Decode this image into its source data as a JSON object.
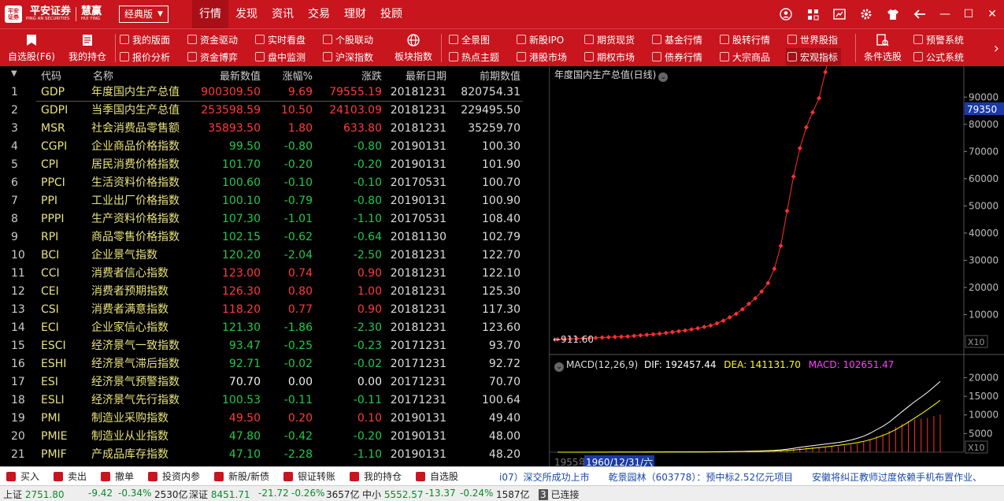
{
  "titlebar": {
    "logo_main": "平安证券",
    "logo_sub": "PING AN SECURITIES",
    "brand": "慧赢",
    "brand_sub": "HUI YING",
    "edition": "经典版",
    "tabs": [
      "行情",
      "发现",
      "资讯",
      "交易",
      "理财",
      "投顾"
    ],
    "active_tab": "行情"
  },
  "toolbar": {
    "big": [
      {
        "label": "自选股(F6)",
        "icon": "bookmark-icon"
      },
      {
        "label": "我的持仓",
        "icon": "document-icon"
      },
      {
        "label": "板块指数",
        "icon": "globe-icon"
      },
      {
        "label": "条件选股",
        "icon": "filter-doc-icon"
      }
    ],
    "small": [
      [
        "我的版面",
        "报价分析"
      ],
      [
        "资金驱动",
        "资金博弈"
      ],
      [
        "实时看盘",
        "盘中监测"
      ],
      [
        "个股联动",
        "沪深指数"
      ],
      [
        "全景图",
        "热点主题"
      ],
      [
        "新股IPO",
        "港股市场"
      ],
      [
        "期货现货",
        "期权市场"
      ],
      [
        "基金行情",
        "债券行情"
      ],
      [
        "股转行情",
        "大宗商品"
      ],
      [
        "世界股指",
        "宏观指标"
      ],
      [
        "预警系统",
        "公式系统"
      ]
    ],
    "selected": "宏观指标"
  },
  "table": {
    "headers": {
      "code": "代码",
      "name": "名称",
      "price": "最新数值",
      "pct": "涨幅%",
      "chg": "涨跌",
      "date": "最新日期",
      "prev": "前期数值"
    },
    "rows": [
      {
        "idx": "1",
        "code": "GDP",
        "name": "年度国内生产总值",
        "price": "900309.50",
        "pct": "9.69",
        "chg": "79555.19",
        "date": "20181231",
        "prev": "820754.31",
        "dir": "up"
      },
      {
        "idx": "2",
        "code": "GDPI",
        "name": "当季国内生产总值",
        "price": "253598.59",
        "pct": "10.50",
        "chg": "24103.09",
        "date": "20181231",
        "prev": "229495.50",
        "dir": "up"
      },
      {
        "idx": "3",
        "code": "MSR",
        "name": "社会消费品零售额",
        "price": "35893.50",
        "pct": "1.80",
        "chg": "633.80",
        "date": "20181231",
        "prev": "35259.70",
        "dir": "up"
      },
      {
        "idx": "4",
        "code": "CGPI",
        "name": "企业商品价格指数",
        "price": "99.50",
        "pct": "-0.80",
        "chg": "-0.80",
        "date": "20190131",
        "prev": "100.30",
        "dir": "down"
      },
      {
        "idx": "5",
        "code": "CPI",
        "name": "居民消费价格指数",
        "price": "101.70",
        "pct": "-0.20",
        "chg": "-0.20",
        "date": "20190131",
        "prev": "101.90",
        "dir": "down"
      },
      {
        "idx": "6",
        "code": "PPCI",
        "name": "生活资料价格指数",
        "price": "100.60",
        "pct": "-0.10",
        "chg": "-0.10",
        "date": "20170531",
        "prev": "100.70",
        "dir": "down"
      },
      {
        "idx": "7",
        "code": "PPI",
        "name": "工业出厂价格指数",
        "price": "100.10",
        "pct": "-0.79",
        "chg": "-0.80",
        "date": "20190131",
        "prev": "100.90",
        "dir": "down"
      },
      {
        "idx": "8",
        "code": "PPPI",
        "name": "生产资料价格指数",
        "price": "107.30",
        "pct": "-1.01",
        "chg": "-1.10",
        "date": "20170531",
        "prev": "108.40",
        "dir": "down"
      },
      {
        "idx": "9",
        "code": "RPI",
        "name": "商品零售价格指数",
        "price": "102.15",
        "pct": "-0.62",
        "chg": "-0.64",
        "date": "20181130",
        "prev": "102.79",
        "dir": "down"
      },
      {
        "idx": "10",
        "code": "BCI",
        "name": "企业景气指数",
        "price": "120.20",
        "pct": "-2.04",
        "chg": "-2.50",
        "date": "20181231",
        "prev": "122.70",
        "dir": "down"
      },
      {
        "idx": "11",
        "code": "CCI",
        "name": "消费者信心指数",
        "price": "123.00",
        "pct": "0.74",
        "chg": "0.90",
        "date": "20181231",
        "prev": "122.10",
        "dir": "up"
      },
      {
        "idx": "12",
        "code": "CEI",
        "name": "消费者预期指数",
        "price": "126.30",
        "pct": "0.80",
        "chg": "1.00",
        "date": "20181231",
        "prev": "125.30",
        "dir": "up"
      },
      {
        "idx": "13",
        "code": "CSI",
        "name": "消费者满意指数",
        "price": "118.20",
        "pct": "0.77",
        "chg": "0.90",
        "date": "20181231",
        "prev": "117.30",
        "dir": "up"
      },
      {
        "idx": "14",
        "code": "ECI",
        "name": "企业家信心指数",
        "price": "121.30",
        "pct": "-1.86",
        "chg": "-2.30",
        "date": "20181231",
        "prev": "123.60",
        "dir": "down"
      },
      {
        "idx": "15",
        "code": "ESCI",
        "name": "经济景气一致指数",
        "price": "93.47",
        "pct": "-0.25",
        "chg": "-0.23",
        "date": "20171231",
        "prev": "93.70",
        "dir": "down"
      },
      {
        "idx": "16",
        "code": "ESHI",
        "name": "经济景气滞后指数",
        "price": "92.71",
        "pct": "-0.02",
        "chg": "-0.02",
        "date": "20171231",
        "prev": "92.72",
        "dir": "down"
      },
      {
        "idx": "17",
        "code": "ESI",
        "name": "经济景气预警指数",
        "price": "70.70",
        "pct": "0.00",
        "chg": "0.00",
        "date": "20171231",
        "prev": "70.70",
        "dir": "flat"
      },
      {
        "idx": "18",
        "code": "ESLI",
        "name": "经济景气先行指数",
        "price": "100.53",
        "pct": "-0.11",
        "chg": "-0.11",
        "date": "20171231",
        "prev": "100.64",
        "dir": "down"
      },
      {
        "idx": "19",
        "code": "PMI",
        "name": "制造业采购指数",
        "price": "49.50",
        "pct": "0.20",
        "chg": "0.10",
        "date": "20190131",
        "prev": "49.40",
        "dir": "up"
      },
      {
        "idx": "20",
        "code": "PMIE",
        "name": "制造业从业指数",
        "price": "47.80",
        "pct": "-0.42",
        "chg": "-0.20",
        "date": "20190131",
        "prev": "48.00",
        "dir": "down"
      },
      {
        "idx": "21",
        "code": "PMIF",
        "name": "产成品库存指数",
        "price": "47.10",
        "pct": "-2.28",
        "chg": "-1.10",
        "date": "20190131",
        "prev": "48.20",
        "dir": "down"
      }
    ]
  },
  "chart": {
    "title": "年度国内生产总值(日线)",
    "peak_label": "900309.50",
    "low_label": "911.60",
    "cursor_value": "79350",
    "y_ticks": [
      "90000",
      "80000",
      "70000",
      "60000",
      "50000",
      "40000",
      "30000",
      "20000",
      "10000"
    ],
    "x10": "X10",
    "macd_title": "MACD(12,26,9)",
    "macd_dif": "DIF: 192457.44",
    "macd_dea": "DEA: 141131.70",
    "macd_val": "MACD: 102651.47",
    "macd_ticks": [
      "20000",
      "15000",
      "10000",
      "5000"
    ],
    "x_start": "1955年",
    "cursor_date": "1960/12/31/六",
    "colors": {
      "price_line": "#ff3030",
      "dif": "#ffffff",
      "dea": "#ffff00",
      "macd": "#ff40ff"
    }
  },
  "chart_data": {
    "type": "line",
    "title": "年度国内生产总值(日线)",
    "note": "GDP index series, rising from 911.60 to 900309.50",
    "series": [
      {
        "name": "GDP",
        "values": [
          911.6,
          1000,
          1100,
          1200,
          1300,
          1400,
          1500,
          1600,
          1700,
          1800,
          1900,
          2000,
          2200,
          2400,
          2600,
          2800,
          3000,
          3300,
          3600,
          3900,
          4200,
          4600,
          5000,
          5500,
          6000,
          6800,
          7800,
          9000,
          10300,
          12000,
          14000,
          16000,
          18500,
          21600,
          26900,
          35300,
          48200,
          60800,
          71200,
          78900,
          84400,
          89600,
          99200,
          109600,
          120300,
          136600,
          161800,
          187300,
          219400,
          270200,
          319500,
          349100,
          413000,
          489300,
          540400,
          595200,
          643600,
          688900,
          746400,
          832000,
          900309.5
        ]
      }
    ],
    "ylabel": "",
    "ylim": [
      0,
      95000
    ]
  },
  "orderbar": {
    "items": [
      "买入",
      "卖出",
      "撤单",
      "投资内参",
      "新股/新债",
      "银证转账",
      "我的持仓",
      "自选股"
    ],
    "ticker": "i07）深交所成功上市　　乾景园林（603778）：预中标2.52亿元项目　　安徽将纠正教师过度依赖手机布置作业、"
  },
  "statusbar": {
    "sh_label": "上证",
    "sh_val": "2751.80",
    "sh_chg": "-9.42",
    "sh_pct": "-0.34%",
    "sh_amt": "2530亿",
    "sz_label": "深证",
    "sz_val": "8451.71",
    "sz_chg": "-21.72",
    "sz_pct": "-0.26%",
    "sz_amt": "3657亿",
    "zx_label": "中小",
    "zx_val": "5552.57",
    "zx_chg": "-13.37",
    "zx_pct": "-0.24%",
    "zx_amt": "1587亿",
    "conn_num": "3",
    "conn": "已连接"
  }
}
